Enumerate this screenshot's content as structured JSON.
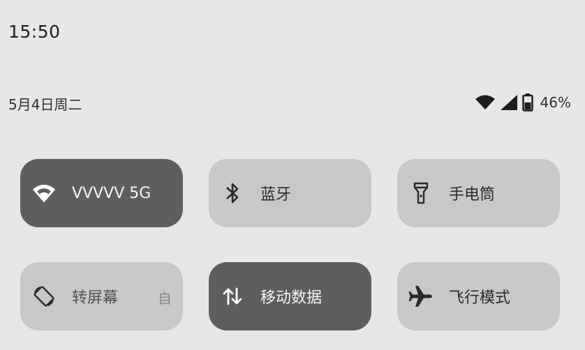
{
  "status_bar": {
    "time": "15:50",
    "date": "5月4日周二",
    "battery_percent": "46%",
    "icons": [
      "wifi-icon",
      "cellular-signal-icon",
      "battery-icon"
    ]
  },
  "tiles": [
    {
      "label": "VVVVV 5G",
      "icon": "wifi-icon",
      "active": true
    },
    {
      "label": "蓝牙",
      "icon": "bluetooth-icon",
      "active": false
    },
    {
      "label": "手电筒",
      "icon": "flashlight-icon",
      "active": false
    },
    {
      "label": "转屏幕",
      "trailing": "自",
      "icon": "auto-rotate-icon",
      "active": false
    },
    {
      "label": "移动数据",
      "icon": "mobile-data-icon",
      "active": true
    },
    {
      "label": "飞行模式",
      "icon": "airplane-icon",
      "active": false
    }
  ],
  "colors": {
    "background": "#e8e6e6",
    "tile_inactive": "#c9c7c7",
    "tile_active": "#5e5e5e"
  }
}
